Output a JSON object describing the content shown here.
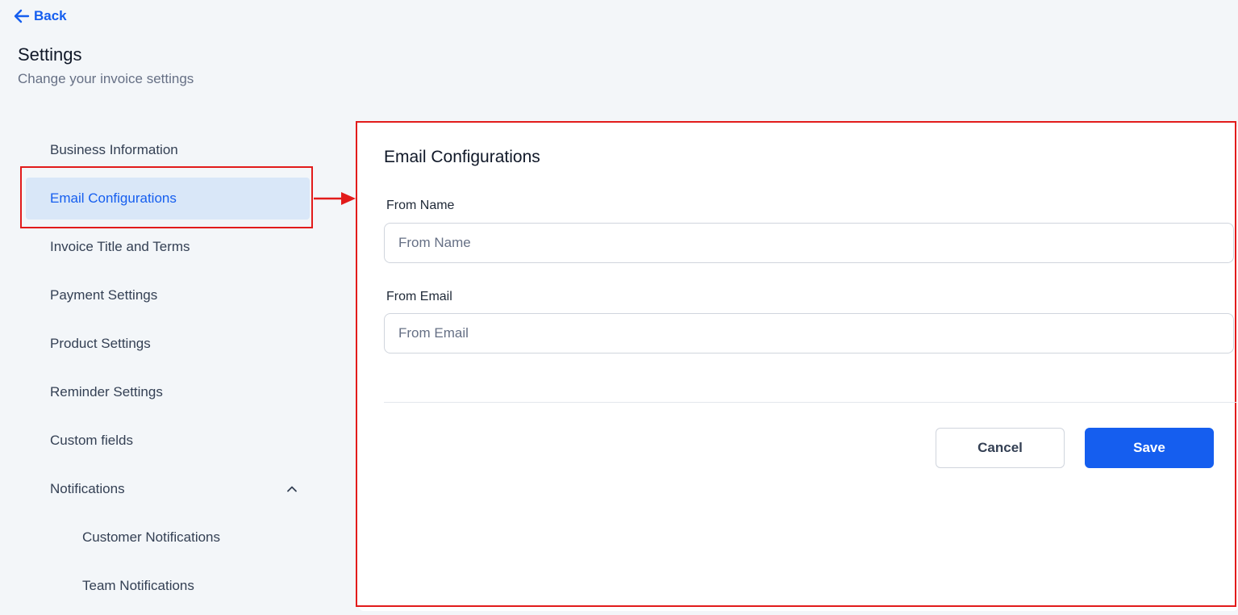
{
  "back": {
    "label": "Back",
    "icon": "arrow-left-icon"
  },
  "header": {
    "title": "Settings",
    "subtitle": "Change your invoice settings"
  },
  "sidebar": {
    "items": [
      {
        "label": "Business Information",
        "active": false
      },
      {
        "label": "Email Configurations",
        "active": true
      },
      {
        "label": "Invoice Title and Terms",
        "active": false
      },
      {
        "label": "Payment Settings",
        "active": false
      },
      {
        "label": "Product Settings",
        "active": false
      },
      {
        "label": "Reminder Settings",
        "active": false
      },
      {
        "label": "Custom fields",
        "active": false
      },
      {
        "label": "Notifications",
        "active": false,
        "expanded": true,
        "icon": "chevron-up-icon"
      },
      {
        "label": "Customer Notifications",
        "active": false,
        "sub": true
      },
      {
        "label": "Team Notifications",
        "active": false,
        "sub": true
      }
    ]
  },
  "main": {
    "title": "Email Configurations",
    "from_name": {
      "label": "From Name",
      "value": "",
      "placeholder": "From Name"
    },
    "from_email": {
      "label": "From Email",
      "value": "",
      "placeholder": "From Email"
    },
    "cancel_label": "Cancel",
    "save_label": "Save"
  },
  "colors": {
    "accent": "#155eef",
    "active_bg": "#d9e7f8",
    "annotation": "#e21b1b",
    "page_bg": "#f3f6f9"
  }
}
